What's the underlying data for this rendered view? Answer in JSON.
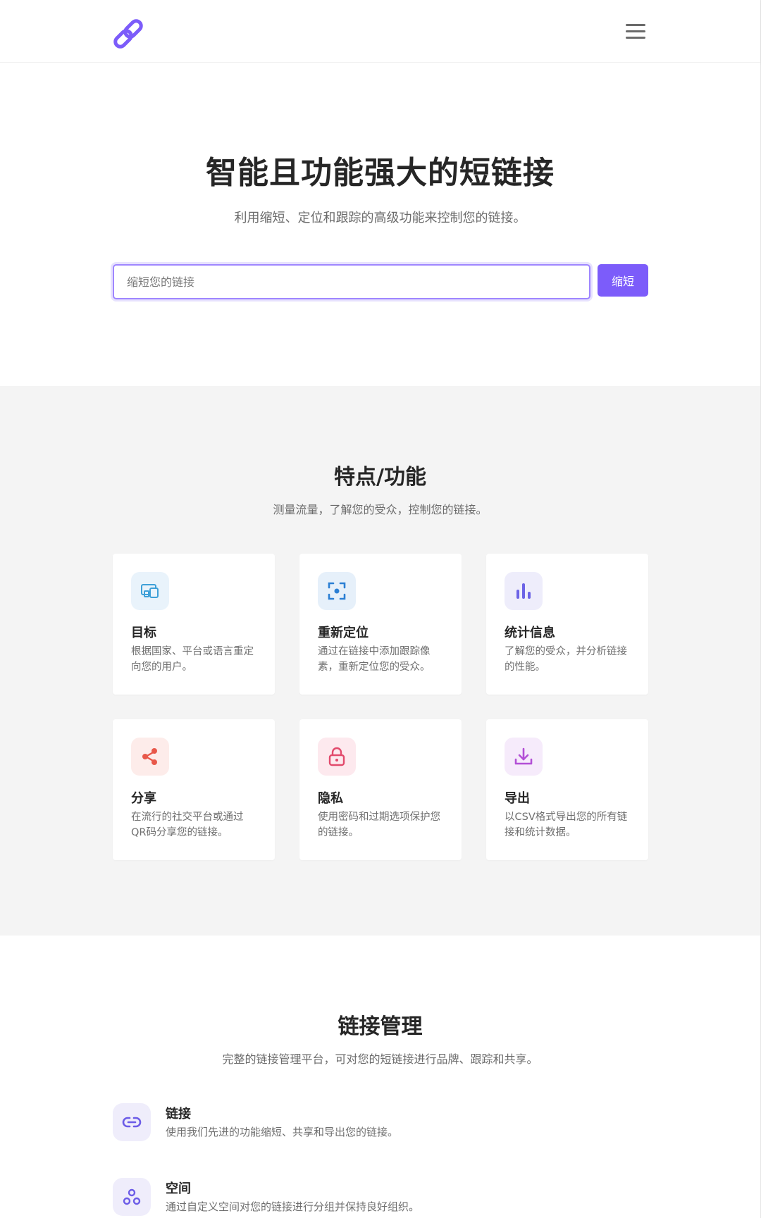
{
  "header": {
    "logo_icon": "link-chain-icon",
    "menu_icon": "hamburger-icon",
    "accent_color": "#7c5cfa"
  },
  "hero": {
    "title": "智能且功能强大的短链接",
    "subtitle": "利用缩短、定位和跟踪的高级功能来控制您的链接。",
    "input_placeholder": "缩短您的链接",
    "input_value": "",
    "button_label": "缩短"
  },
  "features": {
    "title": "特点/功能",
    "subtitle": "测量流量，了解您的受众，控制您的链接。",
    "cards": [
      {
        "icon": "devices-icon",
        "color": "#3ea0d8",
        "bg": "#e9f3fb",
        "title": "目标",
        "desc": "根据国家、平台或语言重定向您的用户。"
      },
      {
        "icon": "focus-target-icon",
        "color": "#2b7fd4",
        "bg": "#e6f0fa",
        "title": "重新定位",
        "desc": "通过在链接中添加跟踪像素，重新定位您的受众。"
      },
      {
        "icon": "bar-chart-icon",
        "color": "#6c63e6",
        "bg": "#eeedfb",
        "title": "统计信息",
        "desc": "了解您的受众，并分析链接的性能。"
      },
      {
        "icon": "share-icon",
        "color": "#e8584a",
        "bg": "#fdecea",
        "title": "分享",
        "desc": "在流行的社交平台或通过QR码分享您的链接。"
      },
      {
        "icon": "lock-icon",
        "color": "#e24a6c",
        "bg": "#fde9ee",
        "title": "隐私",
        "desc": "使用密码和过期选项保护您的链接。"
      },
      {
        "icon": "download-icon",
        "color": "#b350d6",
        "bg": "#f6ebfb",
        "title": "导出",
        "desc": "以CSV格式导出您的所有链接和统计数据。"
      }
    ]
  },
  "management": {
    "title": "链接管理",
    "subtitle": "完整的链接管理平台，可对您的短链接进行品牌、跟踪和共享。",
    "items": [
      {
        "icon": "link-icon",
        "title": "链接",
        "desc": "使用我们先进的功能缩短、共享和导出您的链接。"
      },
      {
        "icon": "spaces-icon",
        "title": "空间",
        "desc": "通过自定义空间对您的链接进行分组并保持良好组织。"
      }
    ]
  }
}
